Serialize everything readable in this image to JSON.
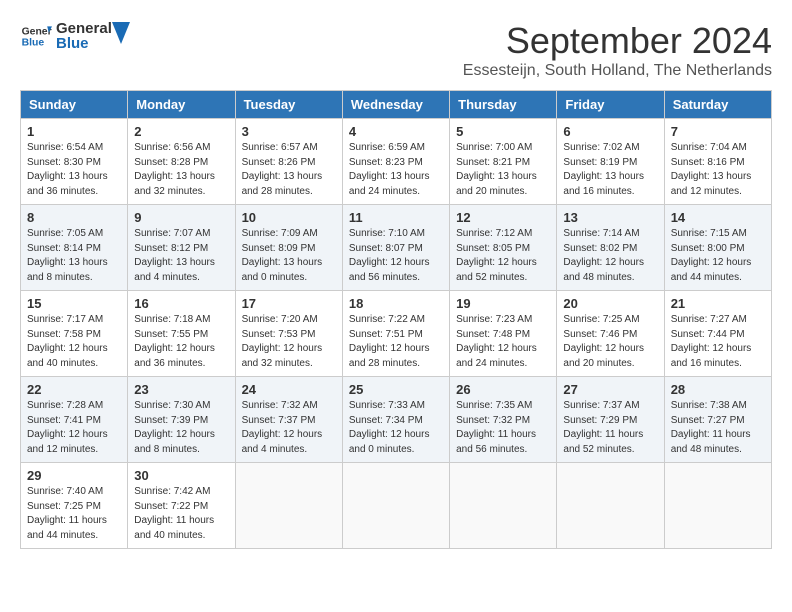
{
  "header": {
    "logo_general": "General",
    "logo_blue": "Blue",
    "month_title": "September 2024",
    "location": "Essesteijn, South Holland, The Netherlands"
  },
  "days_of_week": [
    "Sunday",
    "Monday",
    "Tuesday",
    "Wednesday",
    "Thursday",
    "Friday",
    "Saturday"
  ],
  "weeks": [
    [
      {
        "day": "1",
        "info": "Sunrise: 6:54 AM\nSunset: 8:30 PM\nDaylight: 13 hours\nand 36 minutes."
      },
      {
        "day": "2",
        "info": "Sunrise: 6:56 AM\nSunset: 8:28 PM\nDaylight: 13 hours\nand 32 minutes."
      },
      {
        "day": "3",
        "info": "Sunrise: 6:57 AM\nSunset: 8:26 PM\nDaylight: 13 hours\nand 28 minutes."
      },
      {
        "day": "4",
        "info": "Sunrise: 6:59 AM\nSunset: 8:23 PM\nDaylight: 13 hours\nand 24 minutes."
      },
      {
        "day": "5",
        "info": "Sunrise: 7:00 AM\nSunset: 8:21 PM\nDaylight: 13 hours\nand 20 minutes."
      },
      {
        "day": "6",
        "info": "Sunrise: 7:02 AM\nSunset: 8:19 PM\nDaylight: 13 hours\nand 16 minutes."
      },
      {
        "day": "7",
        "info": "Sunrise: 7:04 AM\nSunset: 8:16 PM\nDaylight: 13 hours\nand 12 minutes."
      }
    ],
    [
      {
        "day": "8",
        "info": "Sunrise: 7:05 AM\nSunset: 8:14 PM\nDaylight: 13 hours\nand 8 minutes."
      },
      {
        "day": "9",
        "info": "Sunrise: 7:07 AM\nSunset: 8:12 PM\nDaylight: 13 hours\nand 4 minutes."
      },
      {
        "day": "10",
        "info": "Sunrise: 7:09 AM\nSunset: 8:09 PM\nDaylight: 13 hours\nand 0 minutes."
      },
      {
        "day": "11",
        "info": "Sunrise: 7:10 AM\nSunset: 8:07 PM\nDaylight: 12 hours\nand 56 minutes."
      },
      {
        "day": "12",
        "info": "Sunrise: 7:12 AM\nSunset: 8:05 PM\nDaylight: 12 hours\nand 52 minutes."
      },
      {
        "day": "13",
        "info": "Sunrise: 7:14 AM\nSunset: 8:02 PM\nDaylight: 12 hours\nand 48 minutes."
      },
      {
        "day": "14",
        "info": "Sunrise: 7:15 AM\nSunset: 8:00 PM\nDaylight: 12 hours\nand 44 minutes."
      }
    ],
    [
      {
        "day": "15",
        "info": "Sunrise: 7:17 AM\nSunset: 7:58 PM\nDaylight: 12 hours\nand 40 minutes."
      },
      {
        "day": "16",
        "info": "Sunrise: 7:18 AM\nSunset: 7:55 PM\nDaylight: 12 hours\nand 36 minutes."
      },
      {
        "day": "17",
        "info": "Sunrise: 7:20 AM\nSunset: 7:53 PM\nDaylight: 12 hours\nand 32 minutes."
      },
      {
        "day": "18",
        "info": "Sunrise: 7:22 AM\nSunset: 7:51 PM\nDaylight: 12 hours\nand 28 minutes."
      },
      {
        "day": "19",
        "info": "Sunrise: 7:23 AM\nSunset: 7:48 PM\nDaylight: 12 hours\nand 24 minutes."
      },
      {
        "day": "20",
        "info": "Sunrise: 7:25 AM\nSunset: 7:46 PM\nDaylight: 12 hours\nand 20 minutes."
      },
      {
        "day": "21",
        "info": "Sunrise: 7:27 AM\nSunset: 7:44 PM\nDaylight: 12 hours\nand 16 minutes."
      }
    ],
    [
      {
        "day": "22",
        "info": "Sunrise: 7:28 AM\nSunset: 7:41 PM\nDaylight: 12 hours\nand 12 minutes."
      },
      {
        "day": "23",
        "info": "Sunrise: 7:30 AM\nSunset: 7:39 PM\nDaylight: 12 hours\nand 8 minutes."
      },
      {
        "day": "24",
        "info": "Sunrise: 7:32 AM\nSunset: 7:37 PM\nDaylight: 12 hours\nand 4 minutes."
      },
      {
        "day": "25",
        "info": "Sunrise: 7:33 AM\nSunset: 7:34 PM\nDaylight: 12 hours\nand 0 minutes."
      },
      {
        "day": "26",
        "info": "Sunrise: 7:35 AM\nSunset: 7:32 PM\nDaylight: 11 hours\nand 56 minutes."
      },
      {
        "day": "27",
        "info": "Sunrise: 7:37 AM\nSunset: 7:29 PM\nDaylight: 11 hours\nand 52 minutes."
      },
      {
        "day": "28",
        "info": "Sunrise: 7:38 AM\nSunset: 7:27 PM\nDaylight: 11 hours\nand 48 minutes."
      }
    ],
    [
      {
        "day": "29",
        "info": "Sunrise: 7:40 AM\nSunset: 7:25 PM\nDaylight: 11 hours\nand 44 minutes."
      },
      {
        "day": "30",
        "info": "Sunrise: 7:42 AM\nSunset: 7:22 PM\nDaylight: 11 hours\nand 40 minutes."
      },
      {
        "day": "",
        "info": ""
      },
      {
        "day": "",
        "info": ""
      },
      {
        "day": "",
        "info": ""
      },
      {
        "day": "",
        "info": ""
      },
      {
        "day": "",
        "info": ""
      }
    ]
  ]
}
